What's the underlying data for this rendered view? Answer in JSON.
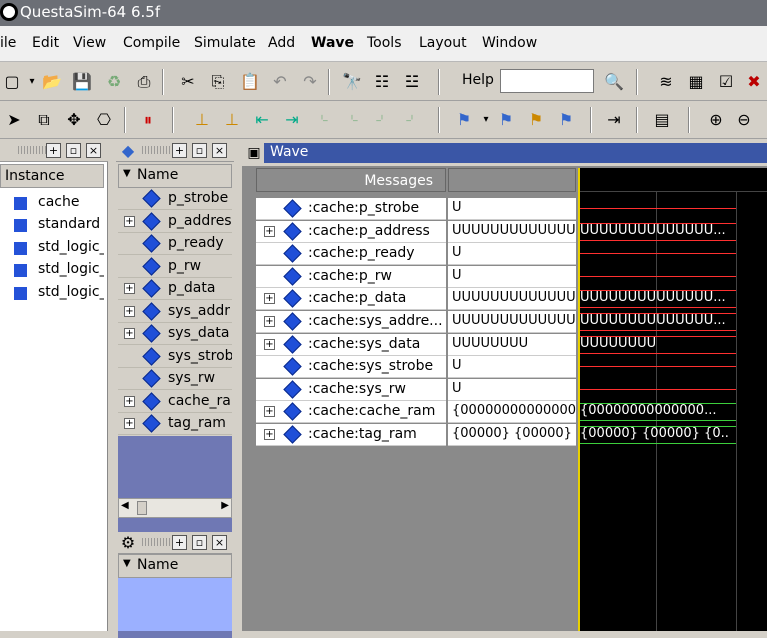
{
  "window": {
    "title": "QuestaSim-64 6.5f"
  },
  "menu": [
    "ile",
    "Edit",
    "View",
    "Compile",
    "Simulate",
    "Add",
    "Wave",
    "Tools",
    "Layout",
    "Window"
  ],
  "toolbar": {
    "help_label": "Help",
    "help_value": ""
  },
  "instance_panel": {
    "column_header": "Instance",
    "items": [
      "cache",
      "standard",
      "std_logic_",
      "std_logic_",
      "std_logic_"
    ]
  },
  "objects_panel": {
    "column_header": "Name",
    "items": [
      {
        "label": "p_strobe",
        "expandable": false
      },
      {
        "label": "p_addres",
        "expandable": true
      },
      {
        "label": "p_ready",
        "expandable": false
      },
      {
        "label": "p_rw",
        "expandable": false
      },
      {
        "label": "p_data",
        "expandable": true
      },
      {
        "label": "sys_addr",
        "expandable": true
      },
      {
        "label": "sys_data",
        "expandable": true
      },
      {
        "label": "sys_strob",
        "expandable": false
      },
      {
        "label": "sys_rw",
        "expandable": false
      },
      {
        "label": "cache_ra",
        "expandable": true
      },
      {
        "label": "tag_ram",
        "expandable": true
      }
    ],
    "second_column_header": "Name"
  },
  "wave_panel": {
    "title": "Wave",
    "messages_header": "Messages",
    "signals": [
      {
        "name": ":cache:p_strobe",
        "expandable": false,
        "value": "U",
        "wave": "U",
        "bus": false
      },
      {
        "name": ":cache:p_address",
        "expandable": true,
        "value": "UUUUUUUUUUUUUU",
        "wave": "UUUUUUUUUUUUUU...",
        "bus": true
      },
      {
        "name": ":cache:p_ready",
        "expandable": false,
        "value": "U",
        "wave": "U",
        "bus": false
      },
      {
        "name": ":cache:p_rw",
        "expandable": false,
        "value": "U",
        "wave": "U",
        "bus": false
      },
      {
        "name": ":cache:p_data",
        "expandable": true,
        "value": "UUUUUUUUUUUUUU",
        "wave": "UUUUUUUUUUUUUU...",
        "bus": true
      },
      {
        "name": ":cache:sys_addre...",
        "expandable": true,
        "value": "UUUUUUUUUUUUUU",
        "wave": "UUUUUUUUUUUUUU...",
        "bus": true
      },
      {
        "name": ":cache:sys_data",
        "expandable": true,
        "value": "UUUUUUUU",
        "wave": "UUUUUUUU",
        "bus": true
      },
      {
        "name": ":cache:sys_strobe",
        "expandable": false,
        "value": "U",
        "wave": "U",
        "bus": false
      },
      {
        "name": ":cache:sys_rw",
        "expandable": false,
        "value": "U",
        "wave": "U",
        "bus": false
      },
      {
        "name": ":cache:cache_ram",
        "expandable": true,
        "value": "{00000000000000",
        "wave": "{00000000000000...",
        "bus": true,
        "green": true
      },
      {
        "name": ":cache:tag_ram",
        "expandable": true,
        "value": "{00000} {00000} {",
        "wave": "{00000} {00000} {0...",
        "bus": true,
        "green": true
      }
    ]
  },
  "colors": {
    "signal_diamond": "#1f4fd8",
    "wave_red": "#ff3030",
    "wave_green": "#3ccf3c",
    "cursor": "#e8d000"
  }
}
